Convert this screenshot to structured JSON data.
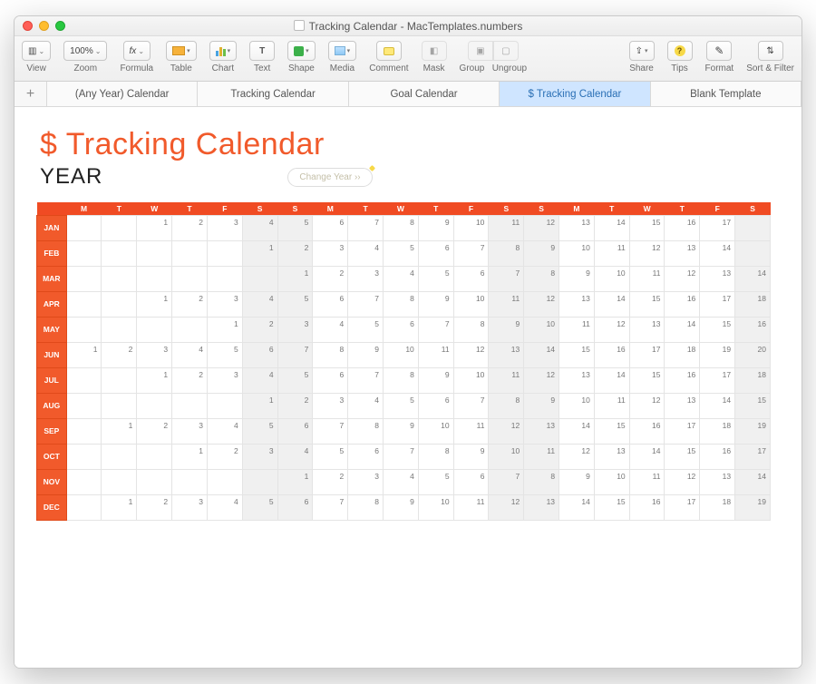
{
  "window": {
    "title": "Tracking Calendar - MacTemplates.numbers"
  },
  "toolbar": {
    "view_label": "View",
    "zoom_value": "100%",
    "zoom_label": "Zoom",
    "formula_label": "Formula",
    "table_label": "Table",
    "chart_label": "Chart",
    "text_label": "Text",
    "text_glyph": "T",
    "shape_label": "Shape",
    "media_label": "Media",
    "comment_label": "Comment",
    "mask_label": "Mask",
    "group_label": "Group",
    "ungroup_label": "Ungroup",
    "share_label": "Share",
    "tips_label": "Tips",
    "format_label": "Format",
    "sort_label": "Sort & Filter"
  },
  "tabs": {
    "add": "+",
    "t0": "(Any Year) Calendar",
    "t1": "Tracking Calendar",
    "t2": "Goal Calendar",
    "t3": "$ Tracking Calendar",
    "t4": "Blank Template",
    "active_index": 3
  },
  "document": {
    "title": "$ Tracking Calendar",
    "year_label": "YEAR",
    "change_year": "Change Year  ››"
  },
  "calendar": {
    "weekdays": [
      "M",
      "T",
      "W",
      "T",
      "F",
      "S",
      "S",
      "M",
      "T",
      "W",
      "T",
      "F",
      "S",
      "S",
      "M",
      "T",
      "W",
      "T",
      "F",
      "S"
    ],
    "weekend_cols": [
      5,
      6,
      12,
      13,
      19
    ],
    "months": [
      {
        "label": "JAN",
        "offset": 2,
        "start": 1,
        "max": 17
      },
      {
        "label": "FEB",
        "offset": 5,
        "start": 1,
        "max": 14
      },
      {
        "label": "MAR",
        "offset": 6,
        "start": 1,
        "max": 14
      },
      {
        "label": "APR",
        "offset": 2,
        "start": 1,
        "max": 18
      },
      {
        "label": "MAY",
        "offset": 4,
        "start": 1,
        "max": 16
      },
      {
        "label": "JUN",
        "offset": 0,
        "start": 1,
        "max": 20
      },
      {
        "label": "JUL",
        "offset": 2,
        "start": 1,
        "max": 18
      },
      {
        "label": "AUG",
        "offset": 5,
        "start": 1,
        "max": 15
      },
      {
        "label": "SEP",
        "offset": 1,
        "start": 1,
        "max": 19
      },
      {
        "label": "OCT",
        "offset": 3,
        "start": 1,
        "max": 17
      },
      {
        "label": "NOV",
        "offset": 6,
        "start": 1,
        "max": 14
      },
      {
        "label": "DEC",
        "offset": 1,
        "start": 1,
        "max": 19
      }
    ]
  }
}
